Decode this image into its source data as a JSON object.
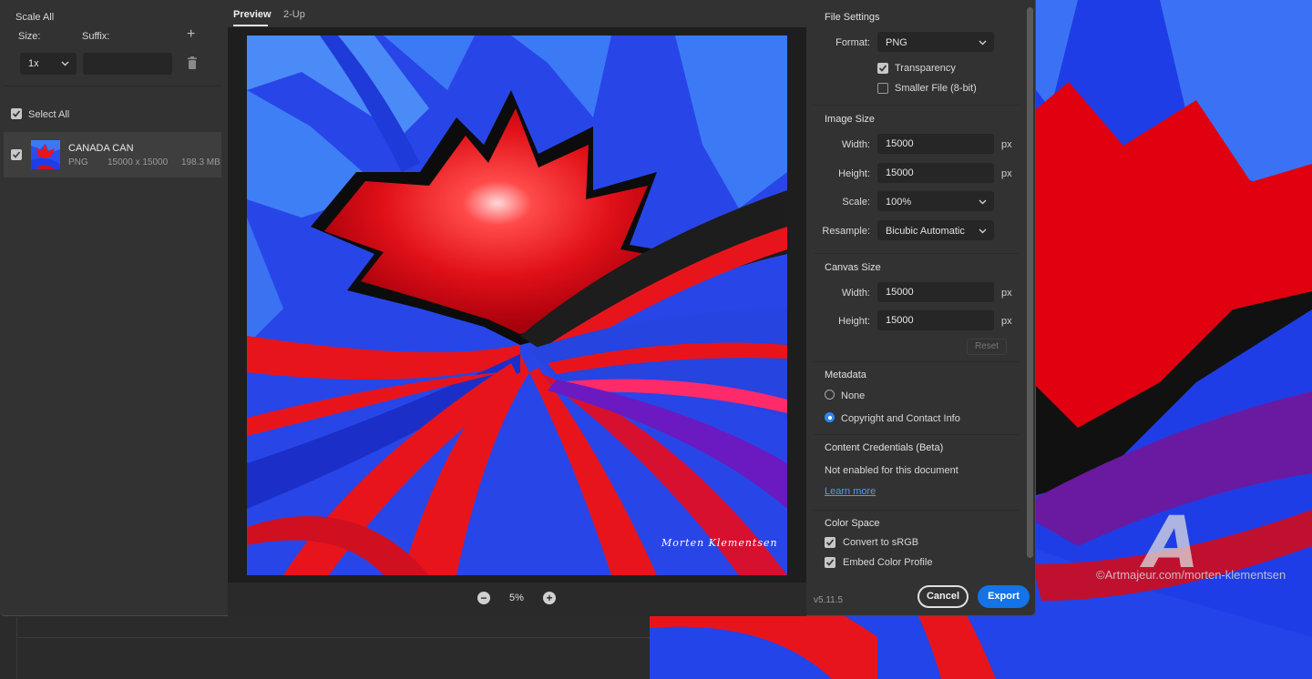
{
  "left_panel": {
    "scale_all_label": "Scale All",
    "size_label": "Size:",
    "suffix_label": "Suffix:",
    "size_value": "1x",
    "suffix_value": "",
    "select_all_label": "Select All",
    "asset": {
      "name": "CANADA CAN",
      "format": "PNG",
      "dimensions": "15000 x 15000",
      "filesize": "198.3 MB",
      "checked": true
    }
  },
  "preview": {
    "tabs": [
      {
        "label": "Preview",
        "active": true
      },
      {
        "label": "2-Up",
        "active": false
      }
    ],
    "zoom": "5%",
    "signature": "Morten Klementsen"
  },
  "file_settings": {
    "title": "File Settings",
    "format_label": "Format:",
    "format_value": "PNG",
    "transparency_label": "Transparency",
    "transparency_checked": true,
    "smaller_file_label": "Smaller File (8-bit)",
    "smaller_file_checked": false
  },
  "image_size": {
    "title": "Image Size",
    "width_label": "Width:",
    "width_value": "15000",
    "height_label": "Height:",
    "height_value": "15000",
    "scale_label": "Scale:",
    "scale_value": "100%",
    "resample_label": "Resample:",
    "resample_value": "Bicubic Automatic",
    "unit": "px"
  },
  "canvas_size": {
    "title": "Canvas Size",
    "width_label": "Width:",
    "width_value": "15000",
    "height_label": "Height:",
    "height_value": "15000",
    "unit": "px",
    "reset_label": "Reset"
  },
  "metadata": {
    "title": "Metadata",
    "options": [
      {
        "label": "None",
        "selected": false
      },
      {
        "label": "Copyright and Contact Info",
        "selected": true
      }
    ]
  },
  "content_credentials": {
    "title": "Content Credentials (Beta)",
    "status": "Not enabled for this document",
    "link": "Learn more"
  },
  "color_space": {
    "title": "Color Space",
    "convert_label": "Convert to sRGB",
    "convert_checked": true,
    "embed_label": "Embed Color Profile",
    "embed_checked": true
  },
  "footer": {
    "version": "v5.11.5",
    "cancel_label": "Cancel",
    "export_label": "Export"
  },
  "watermark": {
    "text": "©Artmajeur.com/morten-klementsen",
    "logo": "A"
  },
  "colors": {
    "accent": "#1473e6",
    "radio_on": "#2f86f2",
    "art_red": "#e8141c",
    "art_blue": "#2a4cf0"
  }
}
